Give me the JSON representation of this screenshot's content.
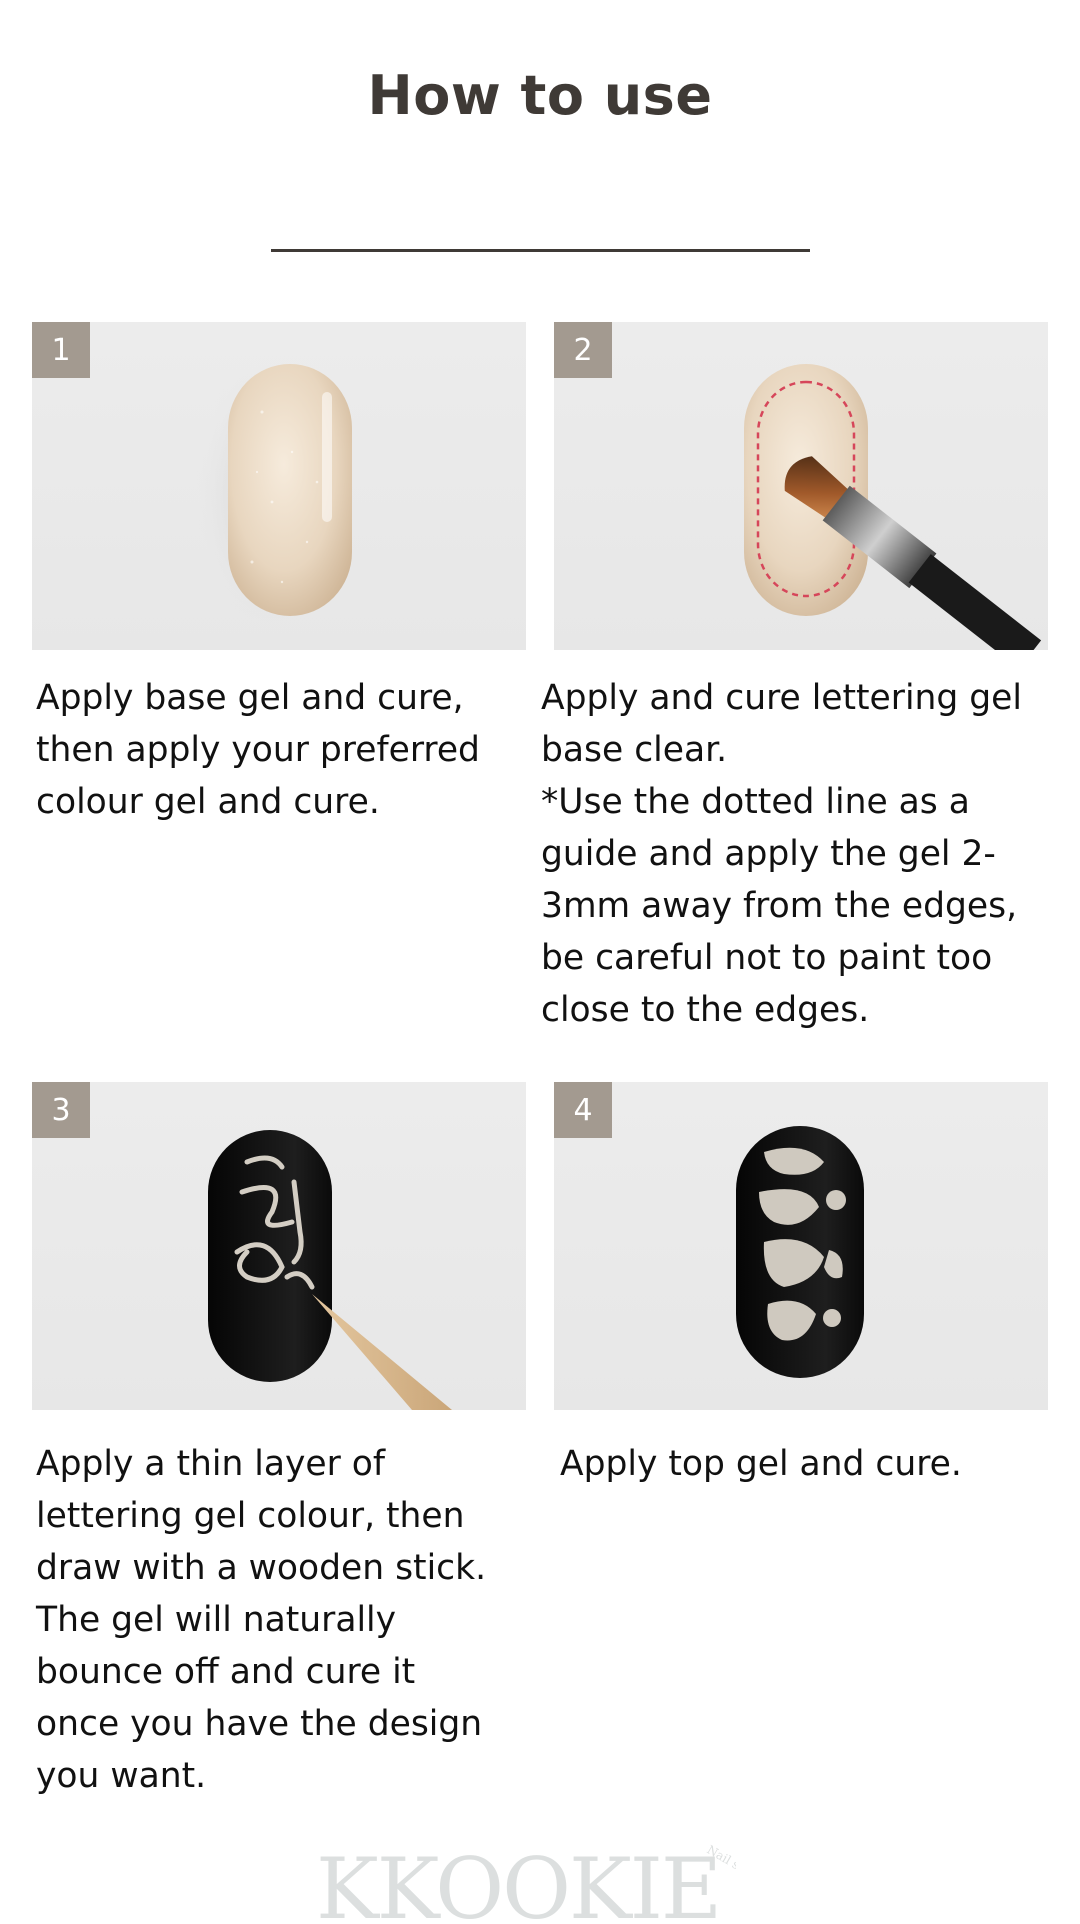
{
  "page": {
    "title": "How to use"
  },
  "steps": [
    {
      "number": "1",
      "text": "Apply base gel and cure,\nthen apply your preferred\ncolour gel and cure."
    },
    {
      "number": "2",
      "text": "Apply and cure lettering gel\nbase clear.\n*Use the dotted line as a\nguide and apply the gel 2-\n3mm away from the edges,\nbe careful not to paint too\nclose to the edges."
    },
    {
      "number": "3",
      "text": "Apply a thin layer of\nlettering gel colour, then\ndraw with a wooden stick.\nThe gel will naturally\nbounce off and cure it\nonce you have the design\nyou want."
    },
    {
      "number": "4",
      "text": "Apply top gel and cure."
    }
  ],
  "footer": {
    "brand": "KKOOKIE",
    "tagline": "Nail supply co."
  },
  "colors": {
    "title": "#3f3a36",
    "badge": "#a39a90",
    "photo_bg": "#e9e9e9",
    "nail_nude": "#e8d6bf",
    "nail_black": "#141414",
    "silver": "#cfc9bf",
    "logo": "#dcdfdf"
  }
}
